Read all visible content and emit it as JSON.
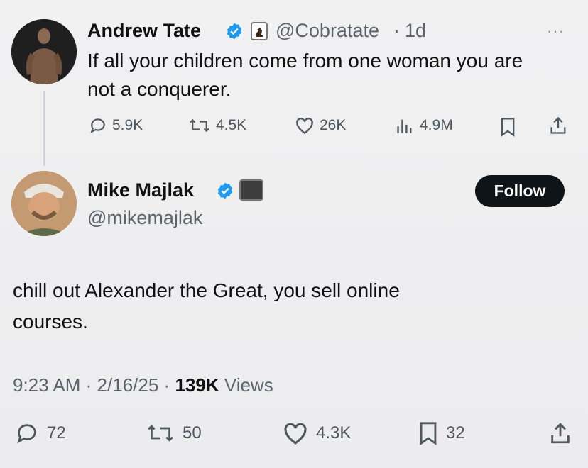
{
  "original_tweet": {
    "author_name": "Andrew Tate",
    "handle": "@Cobratate",
    "separator": "·",
    "time": "1d",
    "text_line1": "If all your children come from one woman you are",
    "text_line2": "not a conquerer.",
    "replies": "5.9K",
    "reposts": "4.5K",
    "likes": "26K",
    "views": "4.9M"
  },
  "reply_tweet": {
    "author_name": "Mike Majlak",
    "handle": "@mikemajlak",
    "follow_label": "Follow",
    "text_line1": "chill out Alexander the Great, you sell online",
    "text_line2": "courses.",
    "time": "9:23 AM",
    "date": "2/16/25",
    "separator": "·",
    "views_count": "139K",
    "views_label": "Views",
    "replies": "72",
    "reposts": "50",
    "likes": "4.3K",
    "bookmarks": "32"
  },
  "colors": {
    "verified_blue": "#1d9bf0",
    "follow_button_bg": "#0f1419"
  },
  "icons": [
    "reply-icon",
    "repost-icon",
    "like-icon",
    "views-icon",
    "bookmark-icon",
    "share-icon",
    "verified-badge-icon",
    "more-icon"
  ]
}
